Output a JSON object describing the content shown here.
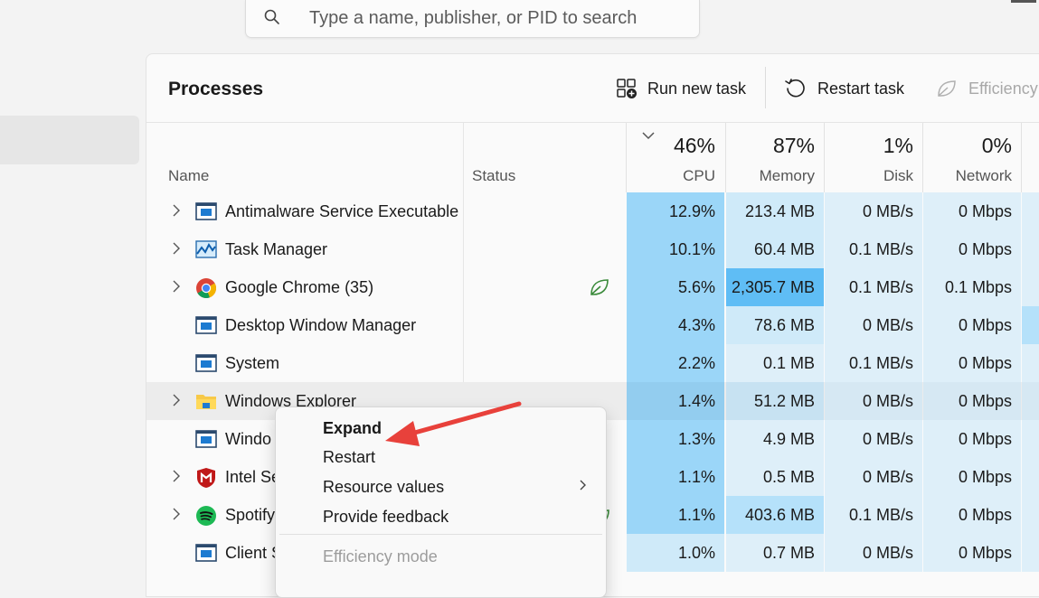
{
  "search": {
    "placeholder": "Type a name, publisher, or PID to search"
  },
  "panel": {
    "title": "Processes",
    "commands": [
      {
        "label": "Run new task",
        "icon": "run-task-icon"
      },
      {
        "label": "Restart task",
        "icon": "restart-icon"
      },
      {
        "label": "Efficiency",
        "icon": "leaf-icon"
      }
    ]
  },
  "columns": {
    "name": "Name",
    "status": "Status",
    "cpu": {
      "percent": "46%",
      "label": "CPU"
    },
    "memory": {
      "percent": "87%",
      "label": "Memory"
    },
    "disk": {
      "percent": "1%",
      "label": "Disk"
    },
    "network": {
      "percent": "0%",
      "label": "Network"
    }
  },
  "processes": [
    {
      "name": "Antimalware Service Executable",
      "cpu": "12.9%",
      "memory": "213.4 MB",
      "disk": "0 MB/s",
      "network": "0 Mbps",
      "icon": "window-app-icon",
      "expandable": true
    },
    {
      "name": "Task Manager",
      "cpu": "10.1%",
      "memory": "60.4 MB",
      "disk": "0.1 MB/s",
      "network": "0 Mbps",
      "icon": "task-manager-icon",
      "expandable": true
    },
    {
      "name": "Google Chrome (35)",
      "cpu": "5.6%",
      "memory": "2,305.7 MB",
      "disk": "0.1 MB/s",
      "network": "0.1 Mbps",
      "icon": "chrome-icon",
      "expandable": true,
      "status_icon": "efficiency-leaf-icon"
    },
    {
      "name": "Desktop Window Manager",
      "cpu": "4.3%",
      "memory": "78.6 MB",
      "disk": "0 MB/s",
      "network": "0 Mbps",
      "icon": "window-app-icon",
      "expandable": false
    },
    {
      "name": "System",
      "cpu": "2.2%",
      "memory": "0.1 MB",
      "disk": "0.1 MB/s",
      "network": "0 Mbps",
      "icon": "window-app-icon",
      "expandable": false
    },
    {
      "name": "Windows Explorer",
      "cpu": "1.4%",
      "memory": "51.2 MB",
      "disk": "0 MB/s",
      "network": "0 Mbps",
      "icon": "folder-icon",
      "expandable": true
    },
    {
      "name": "Windo",
      "cpu": "1.3%",
      "memory": "4.9 MB",
      "disk": "0 MB/s",
      "network": "0 Mbps",
      "icon": "window-app-icon",
      "expandable": false
    },
    {
      "name": "Intel Se",
      "cpu": "1.1%",
      "memory": "0.5 MB",
      "disk": "0 MB/s",
      "network": "0 Mbps",
      "icon": "mcafee-icon",
      "expandable": true
    },
    {
      "name": "Spotify",
      "cpu": "1.1%",
      "memory": "403.6 MB",
      "disk": "0.1 MB/s",
      "network": "0 Mbps",
      "icon": "spotify-icon",
      "expandable": true
    },
    {
      "name": "Client S",
      "cpu": "1.0%",
      "memory": "0.7 MB",
      "disk": "0 MB/s",
      "network": "0 Mbps",
      "icon": "window-app-icon",
      "expandable": false
    }
  ],
  "context_menu": {
    "items": [
      {
        "label": "Expand",
        "bold": true,
        "enabled": true
      },
      {
        "label": "Restart",
        "bold": false,
        "enabled": true
      },
      {
        "label": "Resource values",
        "bold": false,
        "enabled": true,
        "submenu": true
      },
      {
        "label": "Provide feedback",
        "bold": false,
        "enabled": true
      },
      {
        "label": "Efficiency mode",
        "bold": false,
        "enabled": false
      }
    ]
  },
  "colors": {
    "heat_lightest": "#deeff9",
    "heat_light": "#cfeaf9",
    "heat_medium": "#9bd6f8",
    "heat_high": "#5fbdf5",
    "annotation_arrow": "#e8413b"
  }
}
